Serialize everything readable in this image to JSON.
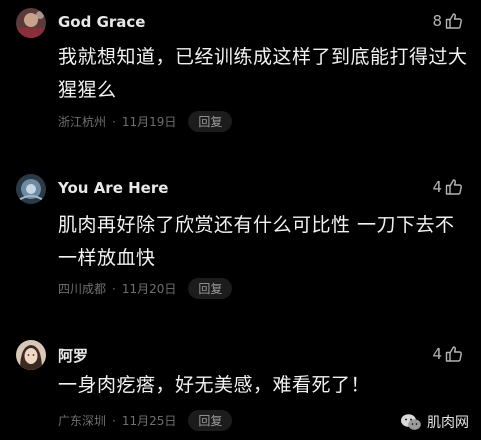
{
  "comments": [
    {
      "username": "God Grace",
      "likes": "8",
      "text": "我就想知道，已经训练成这样了到底能打得过大猩猩么",
      "location": "浙江杭州",
      "dot": "·",
      "date": "11月19日",
      "reply": "回复"
    },
    {
      "username": "You Are Here",
      "likes": "4",
      "text": "肌肉再好除了欣赏还有什么可比性 一刀下去不一样放血快",
      "location": "四川成都",
      "dot": "·",
      "date": "11月20日",
      "reply": "回复"
    },
    {
      "username": "阿罗",
      "likes": "4",
      "text": "一身肉疙瘩，好无美感，难看死了！",
      "location": "广东深圳",
      "dot": "·",
      "date": "11月25日",
      "reply": "回复"
    }
  ],
  "watermark": {
    "label": "肌肉网",
    "icon": "wechat-icon"
  },
  "colors": {
    "background": "#000000",
    "text": "#f2f2f2",
    "meta": "#6f6f6f",
    "reply_bg": "#1c1c1c"
  }
}
